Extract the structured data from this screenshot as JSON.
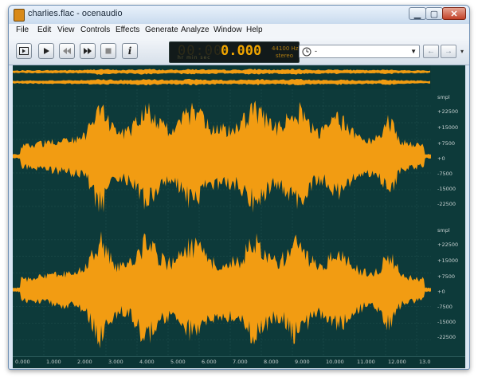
{
  "window": {
    "title": "charlies.flac - ocenaudio",
    "min_glyph": "▁",
    "max_glyph": "▢",
    "close_glyph": "✕"
  },
  "menu": [
    "File",
    "Edit",
    "View",
    "Controls",
    "Effects",
    "Generate",
    "Analyze",
    "Window",
    "Help"
  ],
  "toolbar": {
    "info_label": "i",
    "display": {
      "ghost_digits": "00:00",
      "time": "0.000",
      "units": "hr   min sec",
      "sample_rate": "44100 Hz",
      "channels": "stereo"
    },
    "selector_value": "-",
    "back_glyph": "←",
    "forward_glyph": "→",
    "more_glyph": "▾"
  },
  "scale": {
    "unit": "smpl",
    "ticks": [
      "+22500",
      "+15000",
      "+7500",
      "+0",
      "-7500",
      "-15000",
      "-22500"
    ]
  },
  "time_axis": [
    "0.000",
    "1.000",
    "2.000",
    "3.000",
    "4.000",
    "5.000",
    "6.000",
    "7.000",
    "8.000",
    "9.000",
    "10.000",
    "11.000",
    "12.000",
    "13.0"
  ],
  "colors": {
    "waveform": "#f29c12",
    "background": "#0d3a3a",
    "grid": "#21504f"
  },
  "icons": {
    "zoom": "zoom-in-icon",
    "clock": "clock-icon"
  }
}
